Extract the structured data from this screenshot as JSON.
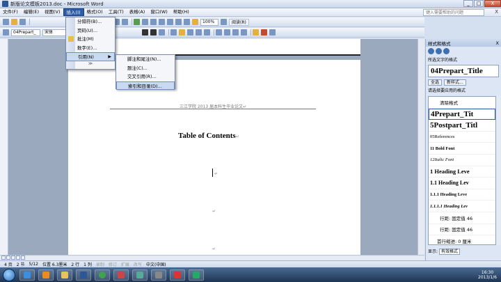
{
  "window": {
    "title": "新版论文模板2013.doc - Microsoft Word",
    "min": "_",
    "max": "□",
    "close": "X"
  },
  "menubar": {
    "items": [
      "文件(F)",
      "编辑(E)",
      "视图(V)",
      "插入(I)",
      "格式(O)",
      "工具(T)",
      "表格(A)",
      "窗口(W)",
      "帮助(H)"
    ],
    "help_placeholder": "键入需要帮助的问题",
    "close_doc": "X"
  },
  "toolbar": {
    "style_value": "04Prepart_",
    "font_value": "宋体",
    "zoom_value": "100%",
    "read_label": "阅读(R)"
  },
  "insert_menu": {
    "items": [
      "分隔符(B)...",
      "页码(U)...",
      "批注(M)",
      "数字(E)...",
      "引用(N)"
    ],
    "expand": "≫"
  },
  "reference_submenu": {
    "items": [
      "脚注和尾注(N)...",
      "题注(C)...",
      "交叉引用(R)...",
      "索引和目录(D)..."
    ]
  },
  "document": {
    "header_text": "三江学院 2013 届本科生毕业论文↵",
    "toc_title": "Table of Contents",
    "title_mark": "↵",
    "cursor_mark": "↵",
    "para_mark_1": "↵",
    "para_mark_2": "↵"
  },
  "task_pane": {
    "title": "样式和格式",
    "close": "X",
    "selected_label": "所选文字的格式",
    "current_style": "04Prepart_Title",
    "select_all": "全选",
    "new_style": "新样式...",
    "apply_label": "请选择要应用的格式",
    "styles": [
      "清除格式",
      "4Prepart_Tit",
      "5Postpart_Titl",
      "05References",
      "11 Bold Font",
      "12Italic Font",
      "1 Heading Leve",
      "1.1 Heading Lev",
      "1.1.1 Heading Leve",
      "1.1.1.1 Heading Lev",
      "行距: 固定值 46",
      "行距: 固定值 46",
      "首行缩进: 0 厘米"
    ],
    "show_label": "显示:",
    "show_value": "有效格式"
  },
  "statusbar": {
    "page": "4 页",
    "section": "2 节",
    "pages": "5/12",
    "position": "位置 6.3厘米",
    "line": "2 行",
    "column": "1 列",
    "rec": "录制",
    "trk": "修订",
    "ext": "扩展",
    "ovr": "改写",
    "lang": "中文(中国)"
  },
  "taskbar": {
    "time": "16:30",
    "date": "2013/1/6"
  },
  "colors": {
    "menu_highlight": "#2d5ca8",
    "taskbar": "#1e3553"
  }
}
